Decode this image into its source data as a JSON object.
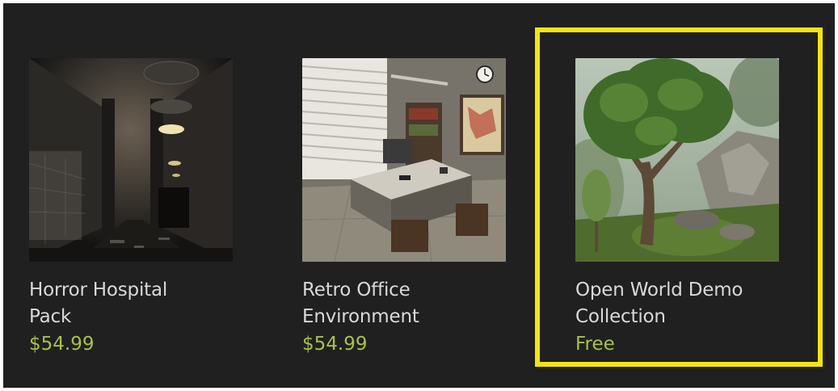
{
  "products": [
    {
      "title": "Horror Hospital\nPack",
      "price": "$54.99",
      "image": "horror-hospital-thumbnail"
    },
    {
      "title": "Retro Office\nEnvironment",
      "price": "$54.99",
      "image": "retro-office-thumbnail"
    },
    {
      "title": "Open World Demo\nCollection",
      "price": "Free",
      "image": "open-world-thumbnail"
    }
  ],
  "highlight": {
    "color": "#f6e40f",
    "target": "open-world-demo-collection"
  },
  "colors": {
    "background": "#202020",
    "title": "#d9d9d9",
    "price": "#a6c14d"
  }
}
